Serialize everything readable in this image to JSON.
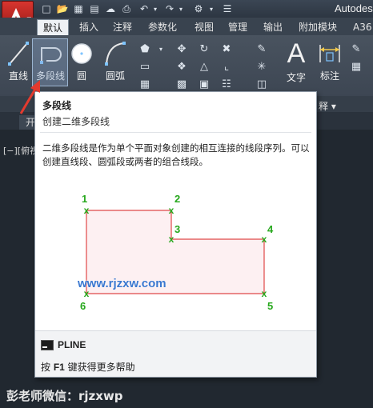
{
  "app": {
    "title": "Autodes"
  },
  "tabs": [
    {
      "label": "默认",
      "active": true
    },
    {
      "label": "插入"
    },
    {
      "label": "注释"
    },
    {
      "label": "参数化"
    },
    {
      "label": "视图"
    },
    {
      "label": "管理"
    },
    {
      "label": "输出"
    },
    {
      "label": "附加模块"
    },
    {
      "label": "A36"
    }
  ],
  "ribbon": {
    "line_label": "直线",
    "polyline_label": "多段线",
    "circle_label": "圆",
    "arc_label": "圆弧",
    "text_label": "文字",
    "dimension_label": "标注",
    "annotation_panel_label": "释 ▾"
  },
  "file_tab_label": "开",
  "viewport_label": "[−][俯视",
  "tooltip": {
    "title": "多段线",
    "subtitle": "创建二维多段线",
    "description": "二维多段线是作为单个平面对象创建的相互连接的线段序列。可以创建直线段、圆弧段或两者的组合线段。",
    "diagram_points": [
      {
        "label": "1"
      },
      {
        "label": "2"
      },
      {
        "label": "3"
      },
      {
        "label": "4"
      },
      {
        "label": "5"
      },
      {
        "label": "6"
      }
    ],
    "command": "PLINE",
    "help_prefix": "按 ",
    "help_key": "F1",
    "help_suffix": " 键获得更多帮助"
  },
  "watermark": "www.rjzxw.com",
  "caption": "彭老师微信：rjzxwp",
  "colors": {
    "accent_red": "#d8352f",
    "diagram_line": "#e04848",
    "diagram_fill": "#fdf0f2",
    "marker_green": "#27a81d",
    "watermark_blue": "#3a78d0"
  }
}
